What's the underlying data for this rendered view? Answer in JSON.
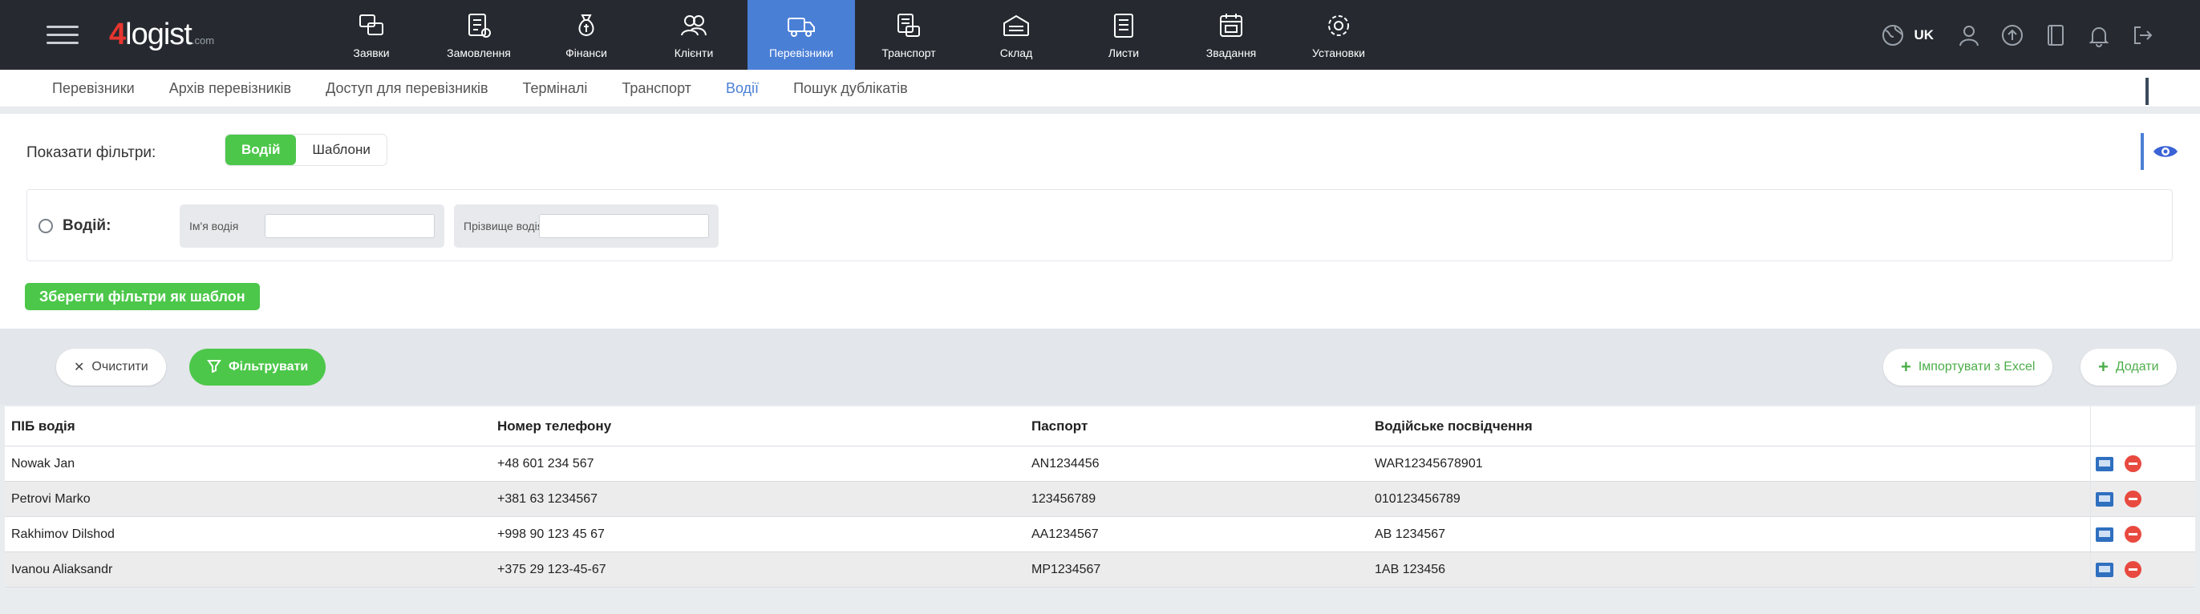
{
  "app": {
    "logo": "4logist",
    "logo_suffix": ".com",
    "lang": "UK"
  },
  "nav": [
    {
      "label": "Заявки",
      "icon": "requests-icon"
    },
    {
      "label": "Замовлення",
      "icon": "orders-icon"
    },
    {
      "label": "Фінанси",
      "icon": "finance-icon"
    },
    {
      "label": "Клієнти",
      "icon": "clients-icon"
    },
    {
      "label": "Перевізники",
      "icon": "truck-icon",
      "active": true
    },
    {
      "label": "Транспорт",
      "icon": "transport-icon"
    },
    {
      "label": "Склад",
      "icon": "warehouse-icon"
    },
    {
      "label": "Листи",
      "icon": "letters-icon"
    },
    {
      "label": "Звадання",
      "icon": "tasks-icon"
    },
    {
      "label": "Установки",
      "icon": "settings-icon"
    }
  ],
  "tabs": [
    "Перевізники",
    "Архів перевізників",
    "Доступ для перевізників",
    "Терміналі",
    "Транспорт",
    "Водії",
    "Пошук дублікатів"
  ],
  "active_tab": "Водії",
  "filters": {
    "show_label": "Показати фільтри:",
    "seg_on": "Водій",
    "seg_off": "Шаблони",
    "driver_label": "Водій:",
    "first_name_label": "Ім'я водія",
    "last_name_label": "Прізвище водія",
    "save_template": "Зберегти фільтри як шаблон"
  },
  "toolbar": {
    "clear": "Очистити",
    "filter": "Фільтрувати",
    "import": "Імпортувати з Excel",
    "add": "Додати"
  },
  "table": {
    "headers": [
      "ПІБ водія",
      "Номер телефону",
      "Паспорт",
      "Водійське посвідчення"
    ],
    "rows": [
      [
        "Nowak Jan",
        "+48 601 234 567",
        "AN1234456",
        "WAR12345678901"
      ],
      [
        "Petrovi Marko",
        "+381 63 1234567",
        "123456789",
        "010123456789"
      ],
      [
        "Rakhimov Dilshod",
        "+998 90 123 45 67",
        "AA1234567",
        "AB 1234567"
      ],
      [
        "Ivanou Aliaksandr",
        "+375 29 123-45-67",
        "MP1234567",
        "1AB 123456"
      ]
    ]
  },
  "colors": {
    "accent": "#4a7fd6",
    "green": "#4cc74a",
    "topbar": "#262a30",
    "danger": "#e84a3f"
  }
}
